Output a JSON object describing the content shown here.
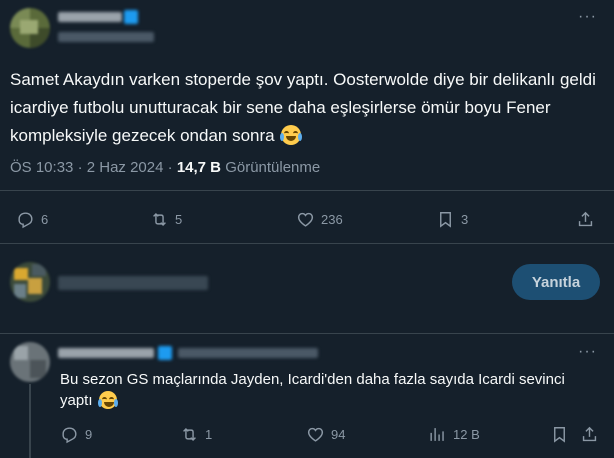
{
  "main_tweet": {
    "text": "Samet Akaydın varken stoperde şov yaptı. Oosterwolde diye bir delikanlı geldi icardiye futbolu unutturacak bir sene daha eşleşirlerse ömür boyu Fener kompleksiyle gezecek ondan sonra",
    "emoji": "face-with-tears-of-joy",
    "time": "ÖS 10:33",
    "separator": "·",
    "date": "2 Haz 2024",
    "views_count": "14,7 B",
    "views_label": "Görüntülenme",
    "stats": {
      "replies": "6",
      "retweets": "5",
      "likes": "236",
      "bookmarks": "3"
    }
  },
  "compose": {
    "reply_button_label": "Yanıtla"
  },
  "reply_tweet": {
    "text": "Bu sezon GS maçlarında Jayden, Icardi'den daha fazla sayıda Icardi sevinci yaptı",
    "emoji": "face-with-tears-of-joy",
    "stats": {
      "replies": "9",
      "retweets": "1",
      "likes": "94",
      "views": "12 B"
    }
  },
  "more_label": "···",
  "colors": {
    "background": "#15202b",
    "text": "#f7f9f9",
    "muted": "#8b98a5",
    "divider": "#38444d",
    "reply_button": "#1d4f73"
  },
  "icons": [
    "more-icon",
    "reply-icon",
    "retweet-icon",
    "like-icon",
    "bookmark-icon",
    "share-icon",
    "views-icon"
  ]
}
